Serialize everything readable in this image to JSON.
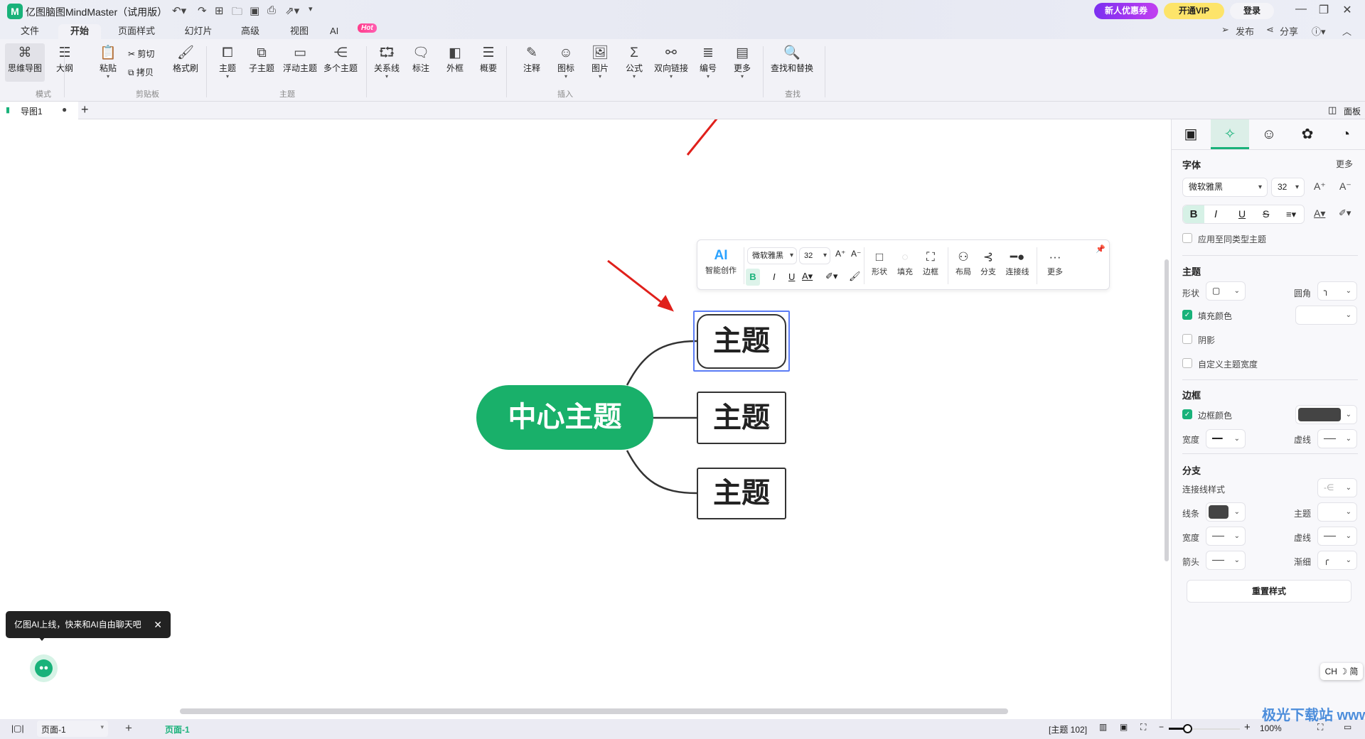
{
  "app": {
    "title": "亿图脑图MindMaster（试用版）",
    "logo": "M"
  },
  "menu_tabs": [
    "文件",
    "开始",
    "页面样式",
    "幻灯片",
    "高级",
    "视图",
    "AI"
  ],
  "hot_badge": "Hot",
  "header_right": {
    "promo": "新人优惠券",
    "vip": "开通VIP",
    "login": "登录",
    "publish": "发布",
    "share": "分享"
  },
  "ribbon": {
    "mode": {
      "label": "模式",
      "items": [
        "思维导图",
        "大纲"
      ]
    },
    "clipboard": {
      "label": "剪贴板",
      "paste": "粘贴",
      "cut": "剪切",
      "copy": "拷贝",
      "format_painter": "格式刷"
    },
    "topic": {
      "label": "主题",
      "items": [
        "主题",
        "子主题",
        "浮动主题",
        "多个主题"
      ]
    },
    "insert": {
      "label": "插入",
      "items": [
        "关系线",
        "标注",
        "外框",
        "概要",
        "注释",
        "图标",
        "图片",
        "公式",
        "双向链接",
        "编号",
        "更多"
      ]
    },
    "find": {
      "label": "查找",
      "item": "查找和替换"
    }
  },
  "doc_tab": {
    "name": "导图1",
    "panel": "面板"
  },
  "mindmap": {
    "central": "中心主题",
    "topics": [
      "主题",
      "主题",
      "主题"
    ],
    "central_color": "#19b06a"
  },
  "float_toolbar": {
    "ai": "AI",
    "ai_label": "智能创作",
    "font": "微软雅黑",
    "size": "32",
    "bold": "B",
    "italic": "I",
    "underline": "U",
    "shape": "形状",
    "fill": "填充",
    "border": "边框",
    "layout": "布局",
    "branch": "分支",
    "connector": "连接线",
    "more": "更多"
  },
  "panel": {
    "font_section": "字体",
    "more": "更多",
    "font": "微软雅黑",
    "size": "32",
    "apply_same": "应用至同类型主题",
    "topic_section": "主题",
    "shape": "形状",
    "corner": "圆角",
    "fill_color": "填充颜色",
    "shadow": "阴影",
    "custom_width": "自定义主题宽度",
    "border_section": "边框",
    "border_color": "边框颜色",
    "width": "宽度",
    "dash": "虚线",
    "branch_section": "分支",
    "connector_style": "连接线样式",
    "line": "线条",
    "topic": "主题",
    "arrow": "箭头",
    "taper": "渐细",
    "reset": "重置样式",
    "fill_checked": true,
    "border_checked": true,
    "shadow_checked": false,
    "apply_checked": false,
    "custom_width_checked": false,
    "border_swatch": "#444444",
    "line_swatch": "#444444"
  },
  "tooltip": "亿图AI上线，快来和AI自由聊天吧",
  "ime": "CH ☽ 简",
  "statusbar": {
    "page_select": "页面-1",
    "page_tab": "页面-1",
    "topic_count": "[主题 102]",
    "zoom": "100%"
  },
  "watermark": "极光下载站 www.xz7.com",
  "accent": "#19b27a"
}
